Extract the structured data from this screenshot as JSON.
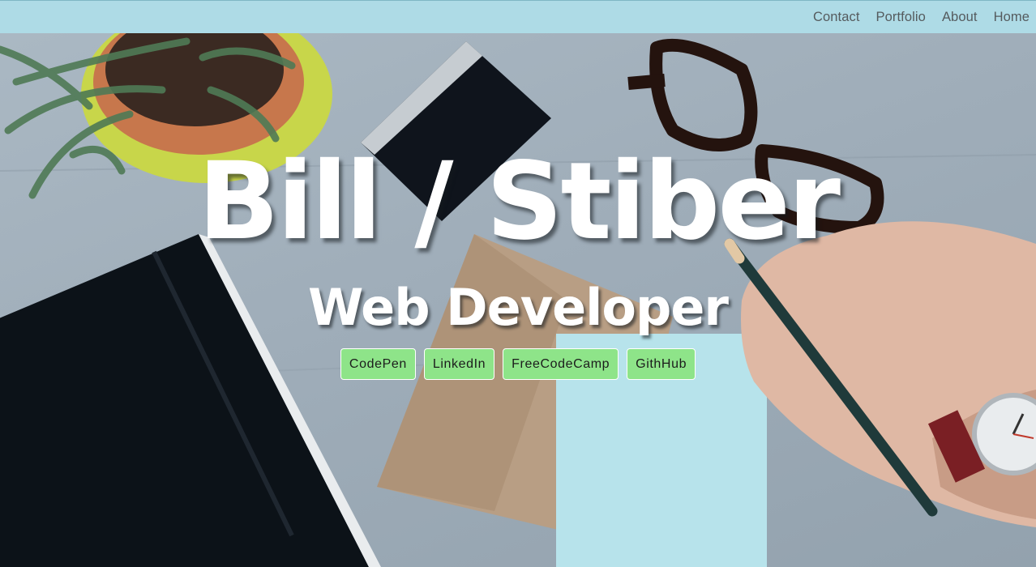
{
  "nav": {
    "links": [
      "Contact",
      "Portfolio",
      "About",
      "Home"
    ]
  },
  "hero": {
    "title": "Bill / Stiber",
    "subtitle": "Web Developer",
    "buttons": [
      "CodePen",
      "LinkedIn",
      "FreeCodeCamp",
      "GithHub"
    ],
    "background_image": "desk-workspace-photo"
  },
  "colors": {
    "navbar": "#aedbe6",
    "button": "#8ee489",
    "nav_text": "#555b5e",
    "headline": "#ffffff"
  }
}
